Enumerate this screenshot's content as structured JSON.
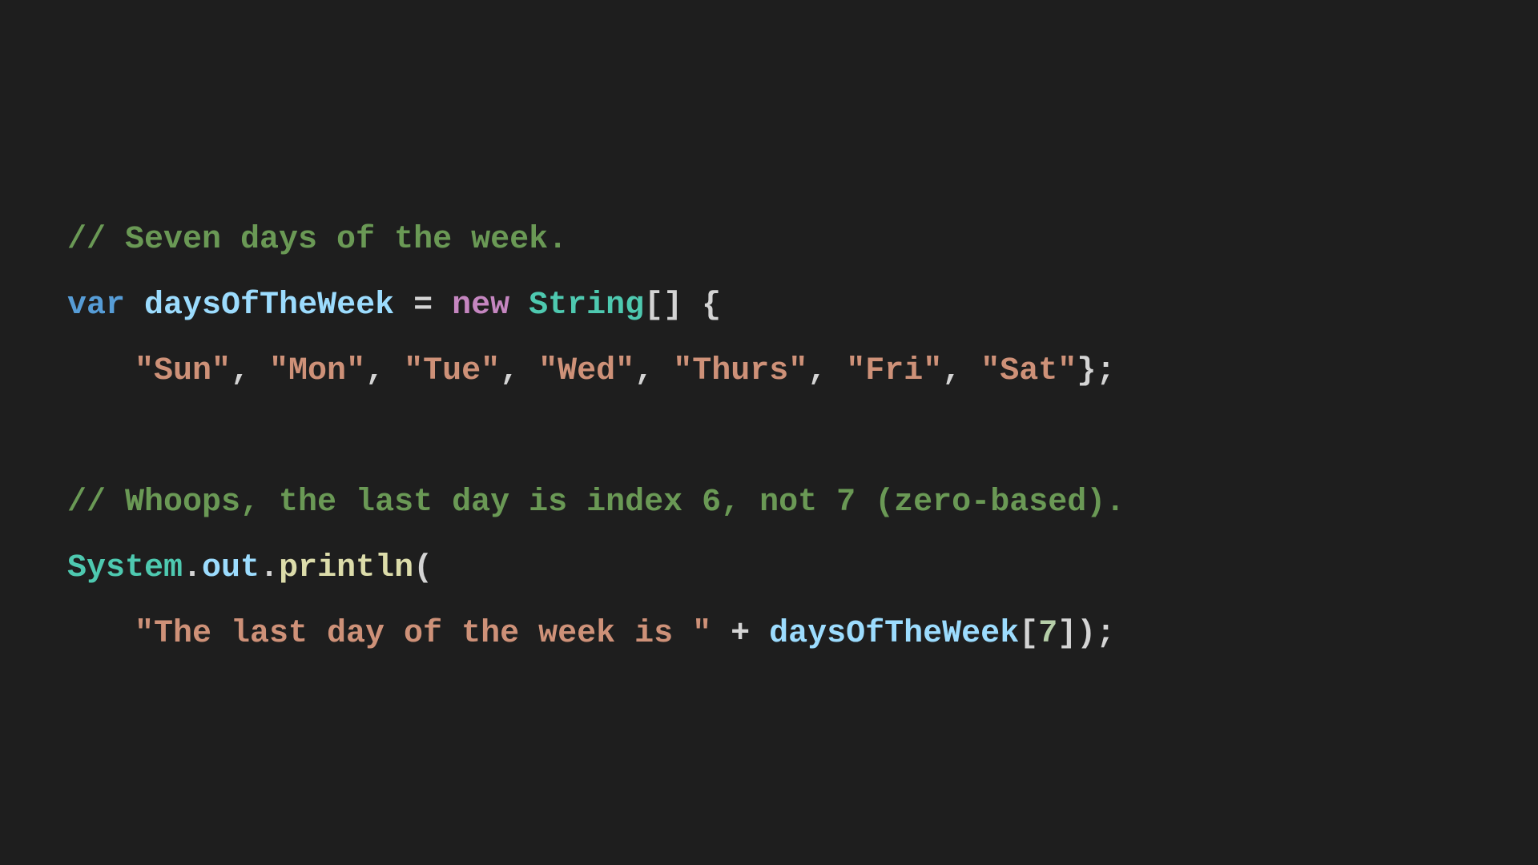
{
  "theme": {
    "background": "#1e1e1e",
    "comment": "#6a9955",
    "keyword_storage": "#569cd6",
    "keyword_control": "#c586c0",
    "type": "#4ec9b0",
    "variable": "#9cdcfe",
    "function": "#dcdcaa",
    "string": "#ce9178",
    "number": "#b5cea8",
    "punctuation": "#d4d4d4"
  },
  "lines": [
    {
      "id": "line-1",
      "indent": false,
      "tokens": [
        {
          "kind": "comment",
          "text": "// Seven days of the week."
        }
      ]
    },
    {
      "id": "line-2",
      "indent": false,
      "tokens": [
        {
          "kind": "keyword_storage",
          "text": "var"
        },
        {
          "kind": "punctuation",
          "text": " "
        },
        {
          "kind": "variable",
          "text": "daysOfTheWeek"
        },
        {
          "kind": "punctuation",
          "text": " = "
        },
        {
          "kind": "keyword_control",
          "text": "new"
        },
        {
          "kind": "punctuation",
          "text": " "
        },
        {
          "kind": "type",
          "text": "String"
        },
        {
          "kind": "punctuation",
          "text": "[] {"
        }
      ]
    },
    {
      "id": "line-3",
      "indent": true,
      "tokens": [
        {
          "kind": "string",
          "text": "\"Sun\""
        },
        {
          "kind": "punctuation",
          "text": ", "
        },
        {
          "kind": "string",
          "text": "\"Mon\""
        },
        {
          "kind": "punctuation",
          "text": ", "
        },
        {
          "kind": "string",
          "text": "\"Tue\""
        },
        {
          "kind": "punctuation",
          "text": ", "
        },
        {
          "kind": "string",
          "text": "\"Wed\""
        },
        {
          "kind": "punctuation",
          "text": ", "
        },
        {
          "kind": "string",
          "text": "\"Thurs\""
        },
        {
          "kind": "punctuation",
          "text": ", "
        },
        {
          "kind": "string",
          "text": "\"Fri\""
        },
        {
          "kind": "punctuation",
          "text": ", "
        },
        {
          "kind": "string",
          "text": "\"Sat\""
        },
        {
          "kind": "punctuation",
          "text": "};"
        }
      ]
    },
    {
      "id": "line-4",
      "indent": false,
      "tokens": []
    },
    {
      "id": "line-5",
      "indent": false,
      "tokens": [
        {
          "kind": "comment",
          "text": "// Whoops, the last day is index 6, not 7 (zero-based)."
        }
      ]
    },
    {
      "id": "line-6",
      "indent": false,
      "tokens": [
        {
          "kind": "type",
          "text": "System"
        },
        {
          "kind": "punctuation",
          "text": "."
        },
        {
          "kind": "variable",
          "text": "out"
        },
        {
          "kind": "punctuation",
          "text": "."
        },
        {
          "kind": "function",
          "text": "println"
        },
        {
          "kind": "punctuation",
          "text": "("
        }
      ]
    },
    {
      "id": "line-7",
      "indent": true,
      "tokens": [
        {
          "kind": "string",
          "text": "\"The last day of the week is \""
        },
        {
          "kind": "punctuation",
          "text": " + "
        },
        {
          "kind": "variable",
          "text": "daysOfTheWeek"
        },
        {
          "kind": "punctuation",
          "text": "["
        },
        {
          "kind": "number",
          "text": "7"
        },
        {
          "kind": "punctuation",
          "text": "]);"
        }
      ]
    }
  ]
}
